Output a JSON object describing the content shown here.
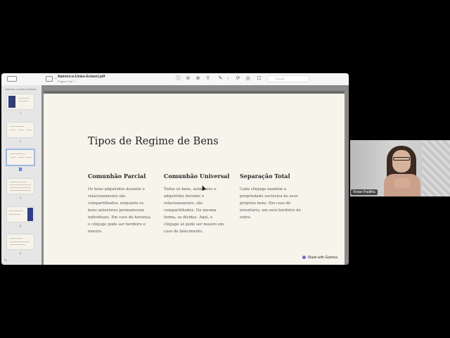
{
  "window": {
    "doc_title": "Namoro-e-Uniao-Estavel.pdf",
    "page_indicator": "Página 3 de 7",
    "search_placeholder": "Buscar"
  },
  "sidebar": {
    "title": "Namoro-e-Uniao-Estavel...",
    "thumbnails": [
      {
        "page": "1",
        "selected": false
      },
      {
        "page": "2",
        "selected": false
      },
      {
        "page": "3",
        "selected": true
      },
      {
        "page": "4",
        "selected": false
      },
      {
        "page": "5",
        "selected": false
      },
      {
        "page": "6",
        "selected": false
      }
    ]
  },
  "slide": {
    "title": "Tipos de Regime de Bens",
    "columns": [
      {
        "heading": "Comunhão Parcial",
        "body": "Os bens adquiridos durante o relacionamento são compartilhados, enquanto os bens anteriores permanecem individuais. Em caso de herança, o cônjuge pode ser herdeiro e meeiro."
      },
      {
        "heading": "Comunhão Universal",
        "body": "Todos os bens, anteriores e adquiridos durante o relacionamento, são compartilhados. Da mesma forma, as dívidas. Aqui, o cônjuge só pode ser meeiro em caso de falecimento."
      },
      {
        "heading": "Separação Total",
        "body": "Cada cônjuge mantém a propriedade exclusiva de seus próprios bens. Em caso de inventário, um será herdeiro do outro."
      }
    ],
    "badge": "Made with Gamma"
  },
  "webcam": {
    "participant_name": "Vivian Padilha"
  }
}
